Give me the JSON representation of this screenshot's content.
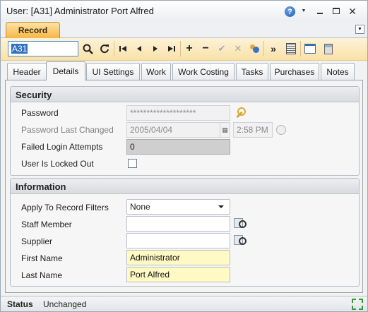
{
  "window": {
    "title": "User: [A31] Administrator Port Alfred"
  },
  "record_tab": {
    "label": "Record"
  },
  "toolbar": {
    "code_value": "A31",
    "icons": [
      "search-icon",
      "refresh-icon",
      "first-record-icon",
      "previous-record-icon",
      "next-record-icon",
      "last-record-icon",
      "add-icon",
      "remove-icon",
      "save-icon",
      "cancel-icon",
      "users-icon",
      "more-icon",
      "notes-icon",
      "window-icon",
      "calculator-icon"
    ]
  },
  "tabs": [
    {
      "label": "Header",
      "active": false
    },
    {
      "label": "Details",
      "active": true
    },
    {
      "label": "UI Settings",
      "active": false
    },
    {
      "label": "Work",
      "active": false
    },
    {
      "label": "Work Costing",
      "active": false
    },
    {
      "label": "Tasks",
      "active": false
    },
    {
      "label": "Purchases",
      "active": false
    },
    {
      "label": "Notes",
      "active": false
    }
  ],
  "security": {
    "heading": "Security",
    "password_label": "Password",
    "password_value": "********************",
    "password_last_changed_label": "Password Last Changed",
    "password_last_changed_date": "2005/04/04",
    "password_last_changed_time": "2:58 PM",
    "failed_login_label": "Failed Login Attempts",
    "failed_login_value": "0",
    "locked_out_label": "User Is Locked Out",
    "locked_out_checked": false
  },
  "information": {
    "heading": "Information",
    "apply_filters_label": "Apply To Record Filters",
    "apply_filters_value": "None",
    "staff_member_label": "Staff Member",
    "staff_member_value": "",
    "supplier_label": "Supplier",
    "supplier_value": "",
    "first_name_label": "First Name",
    "first_name_value": "Administrator",
    "last_name_label": "Last Name",
    "last_name_value": "Port Alfred"
  },
  "status": {
    "label": "Status",
    "value": "Unchanged"
  },
  "colors": {
    "record_tab": "#f6b645",
    "toolbar": "#fbe8b8",
    "required_field": "#fff9c4"
  }
}
